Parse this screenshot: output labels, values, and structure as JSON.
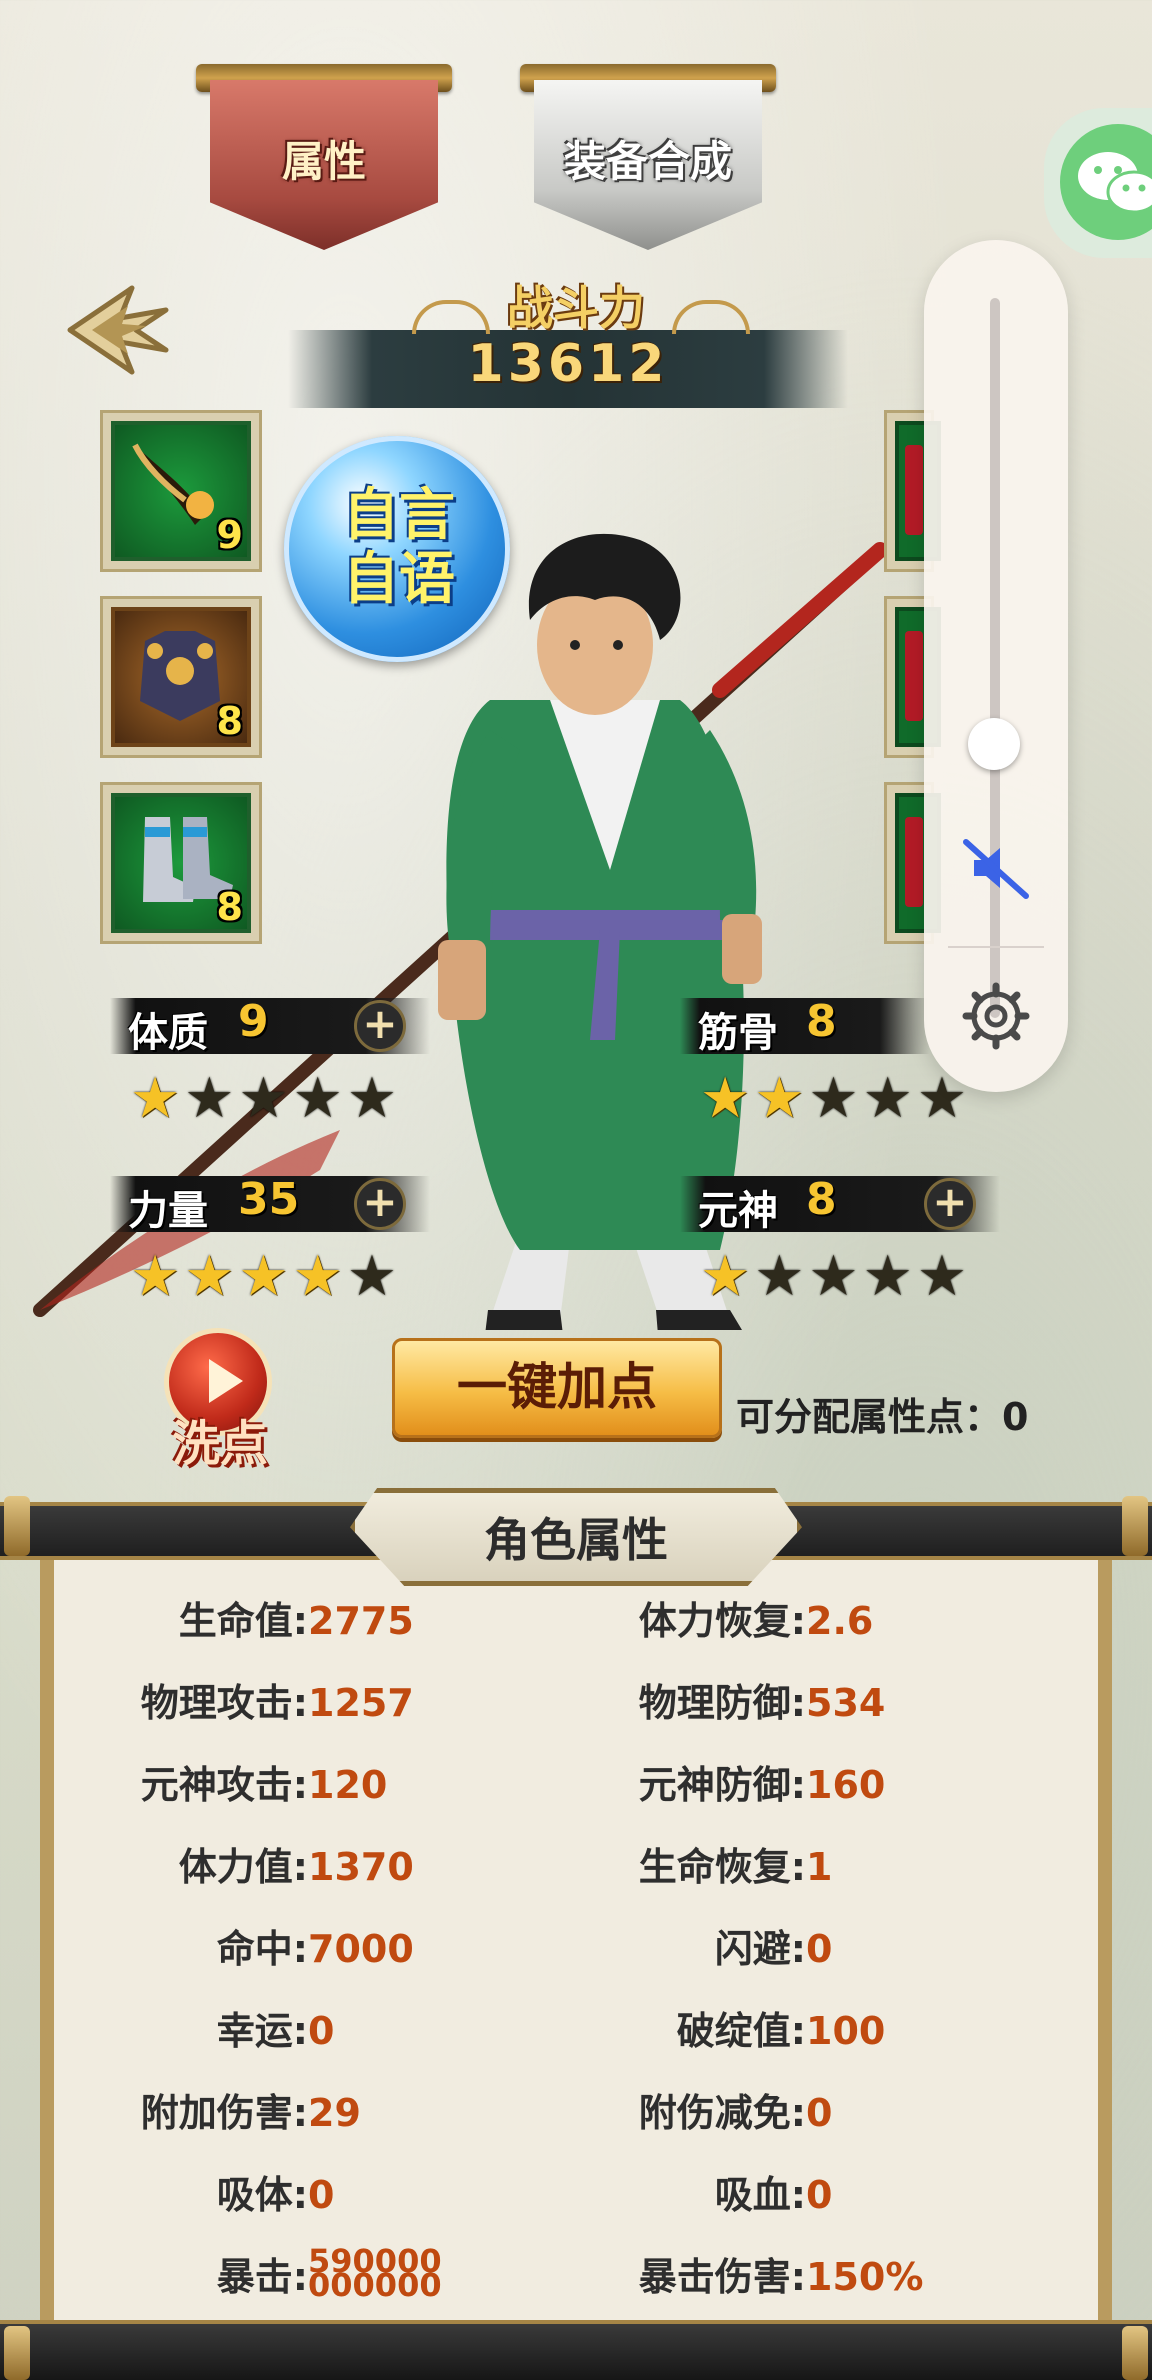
{
  "tabs": [
    {
      "label": "属性",
      "active": true
    },
    {
      "label": "装备合成",
      "active": false
    }
  ],
  "combat_power": {
    "title": "战斗力",
    "value": "13612"
  },
  "equipment_left": [
    {
      "level": "9",
      "kind": "weapon"
    },
    {
      "level": "8",
      "kind": "armor"
    },
    {
      "level": "8",
      "kind": "boots"
    }
  ],
  "chat_bubble": {
    "line1": "自言",
    "line2": "自语"
  },
  "attributes": {
    "constitution": {
      "name": "体质",
      "value": "9",
      "stars": 1,
      "max_stars": 5
    },
    "bones": {
      "name": "筋骨",
      "value": "8",
      "stars": 2,
      "max_stars": 5
    },
    "strength": {
      "name": "力量",
      "value": "35",
      "stars": 4,
      "max_stars": 5
    },
    "spirit": {
      "name": "元神",
      "value": "8",
      "stars": 1,
      "max_stars": 5
    },
    "plus_symbol": "+"
  },
  "actions": {
    "reset_label": "洗点",
    "one_key_label": "一键加点",
    "free_points_label": "可分配属性点：",
    "free_points_value": "0"
  },
  "stats_panel": {
    "title": "角色属性",
    "left": [
      {
        "key": "生命值:",
        "value": "2775"
      },
      {
        "key": "物理攻击:",
        "value": "1257"
      },
      {
        "key": "元神攻击:",
        "value": "120"
      },
      {
        "key": "体力值:",
        "value": "1370"
      },
      {
        "key": "命中:",
        "value": "7000"
      },
      {
        "key": "幸运:",
        "value": "0"
      },
      {
        "key": "附加伤害:",
        "value": "29"
      },
      {
        "key": "吸体:",
        "value": "0"
      },
      {
        "key": "暴击:",
        "value": "590000",
        "value2": "000000"
      }
    ],
    "right": [
      {
        "key": "体力恢复:",
        "value": "2.6"
      },
      {
        "key": "物理防御:",
        "value": "534"
      },
      {
        "key": "元神防御:",
        "value": "160"
      },
      {
        "key": "生命恢复:",
        "value": "1"
      },
      {
        "key": "闪避:",
        "value": "0"
      },
      {
        "key": "破绽值:",
        "value": "100"
      },
      {
        "key": "附伤减免:",
        "value": "0"
      },
      {
        "key": "吸血:",
        "value": "0"
      },
      {
        "key": "暴击伤害:",
        "value": "150%"
      }
    ]
  },
  "volume_overlay": {
    "level": 0.38,
    "muted": true,
    "icons": [
      "mute-icon",
      "settings-gear-icon"
    ]
  },
  "colors": {
    "stat_value": "#c04a10",
    "attr_value": "#f7c531",
    "mute_blue": "#3b63e6",
    "wechat_green": "#6ecf7c"
  }
}
